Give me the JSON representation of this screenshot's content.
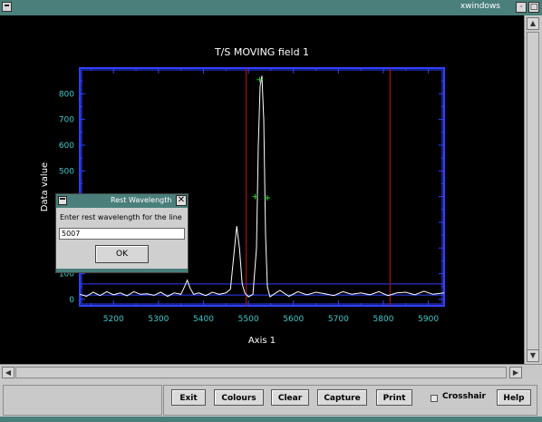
{
  "window": {
    "title": "xwindows"
  },
  "chart_data": {
    "type": "line",
    "title": "T/S MOVING field 1",
    "xlabel": "Axis 1",
    "ylabel": "Data value",
    "xlim": [
      5125,
      5935
    ],
    "ylim": [
      -25,
      900
    ],
    "x_ticks": [
      5200,
      5300,
      5400,
      5500,
      5600,
      5700,
      5800,
      5900
    ],
    "y_ticks": [
      0,
      100,
      200,
      300,
      400,
      500,
      600,
      700,
      800
    ],
    "series": [
      {
        "x": [
          5125,
          5140,
          5155,
          5170,
          5185,
          5200,
          5215,
          5230,
          5245,
          5260,
          5275,
          5290,
          5305,
          5320,
          5335,
          5350,
          5358,
          5364,
          5370,
          5378,
          5390,
          5405,
          5420,
          5435,
          5450,
          5460,
          5468,
          5474,
          5480,
          5486,
          5492,
          5500,
          5510,
          5518,
          5522,
          5526,
          5530,
          5534,
          5538,
          5542,
          5548,
          5556,
          5570,
          5590,
          5610,
          5630,
          5650,
          5670,
          5690,
          5710,
          5730,
          5750,
          5770,
          5790,
          5810,
          5830,
          5850,
          5870,
          5890,
          5910,
          5935
        ],
        "y": [
          20,
          12,
          28,
          15,
          30,
          18,
          25,
          14,
          30,
          20,
          22,
          16,
          28,
          12,
          25,
          20,
          50,
          75,
          45,
          20,
          25,
          15,
          28,
          20,
          25,
          40,
          180,
          285,
          200,
          60,
          25,
          10,
          20,
          200,
          600,
          830,
          870,
          700,
          250,
          50,
          10,
          20,
          35,
          12,
          30,
          18,
          28,
          22,
          15,
          30,
          20,
          25,
          18,
          30,
          15,
          25,
          28,
          18,
          32,
          20,
          25
        ]
      }
    ],
    "markers": [
      {
        "x": 5525,
        "y": 855
      },
      {
        "x": 5515,
        "y": 400
      },
      {
        "x": 5542,
        "y": 395
      }
    ],
    "vertical_lines": [
      5495,
      5815
    ],
    "horizontal_lines": [
      60,
      17
    ],
    "colors": {
      "background": "#000000",
      "frame": "#3040ff",
      "tick_labels": "#40c8c8",
      "text": "#ffffff",
      "data": "#ffffff",
      "vlines": "#aa1010",
      "markers": "#30d030"
    }
  },
  "dialog": {
    "title": "Rest Wavelength",
    "prompt": "Enter rest wavelength for the line",
    "value": "5007",
    "ok": "OK"
  },
  "toolbar": {
    "exit": "Exit",
    "colours": "Colours",
    "clear": "Clear",
    "capture": "Capture",
    "print": "Print",
    "crosshair": "Crosshair",
    "help": "Help"
  },
  "icons": {
    "window_menu": "window-menu-icon",
    "minimize": "minimize-icon",
    "maximize": "maximize-icon",
    "scroll_up": "scroll-up-icon",
    "scroll_down": "scroll-down-icon",
    "scroll_left": "scroll-left-icon",
    "scroll_right": "scroll-right-icon",
    "close": "close-icon"
  }
}
